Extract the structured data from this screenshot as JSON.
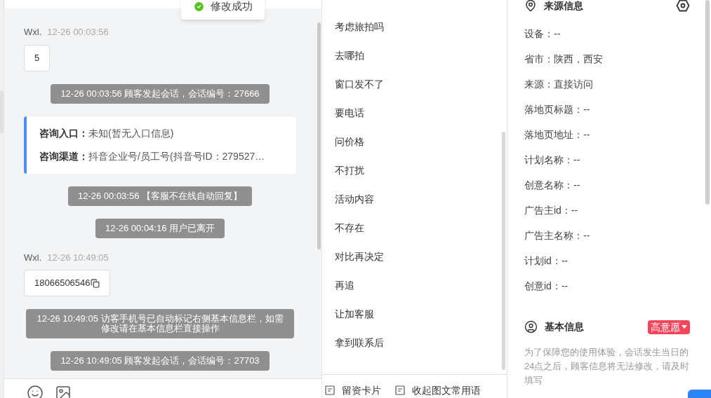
{
  "toast": {
    "text": "修改成功"
  },
  "chat": {
    "messages": [
      {
        "kind": "user",
        "sender": "Wxl.",
        "time": "12-26 00:03:56",
        "text": "5",
        "copyable": false
      },
      {
        "kind": "system",
        "text": "12-26 00:03:56 顾客发起会话，会话编号：27666"
      },
      {
        "kind": "entry_card",
        "rows": [
          {
            "label": "咨询入口：",
            "value": "未知(暂无入口信息)"
          },
          {
            "label": "咨询渠道：",
            "value": "抖音企业号/员工号(抖音号ID：279527…"
          }
        ]
      },
      {
        "kind": "system",
        "text": "12-26 00:03:56 【客服不在线自动回复】"
      },
      {
        "kind": "system",
        "text": "12-26 00:04:16 用户已离开"
      },
      {
        "kind": "user",
        "sender": "Wxl.",
        "time": "12-26 10:49:05",
        "text": "18066506546",
        "copyable": true
      },
      {
        "kind": "system",
        "text": "12-26 10:49:05 访客手机号已自动标记右侧基本信息栏，如需修改请在基本信息栏直接操作"
      },
      {
        "kind": "system",
        "text": "12-26 10:49:05 顾客发起会话，会话编号：27703"
      }
    ]
  },
  "quick_replies": {
    "items": [
      "考虑旅拍吗",
      "去哪拍",
      "窗口发不了",
      "要电话",
      "问价格",
      "不打扰",
      "活动内容",
      "不存在",
      "对比再决定",
      "再追",
      "让加客服",
      "拿到联系后"
    ],
    "actions": [
      "留资卡片",
      "收起图文常用语"
    ]
  },
  "source_info": {
    "title": "来源信息",
    "fields": [
      "设备：--",
      "省市：陕西，西安",
      "来源：直接访问",
      "落地页标题：--",
      "落地页地址：--",
      "计划名称：--",
      "创意名称：--",
      "广告主id：--",
      "广告主名称：--",
      "计划id：--",
      "创意id：--"
    ]
  },
  "basic_info": {
    "title": "基本信息",
    "intent_tag": "高意愿",
    "notice": "为了保障您的使用体验，会话发生当日的24点之后，顾客信息将无法修改，请及时填写"
  }
}
